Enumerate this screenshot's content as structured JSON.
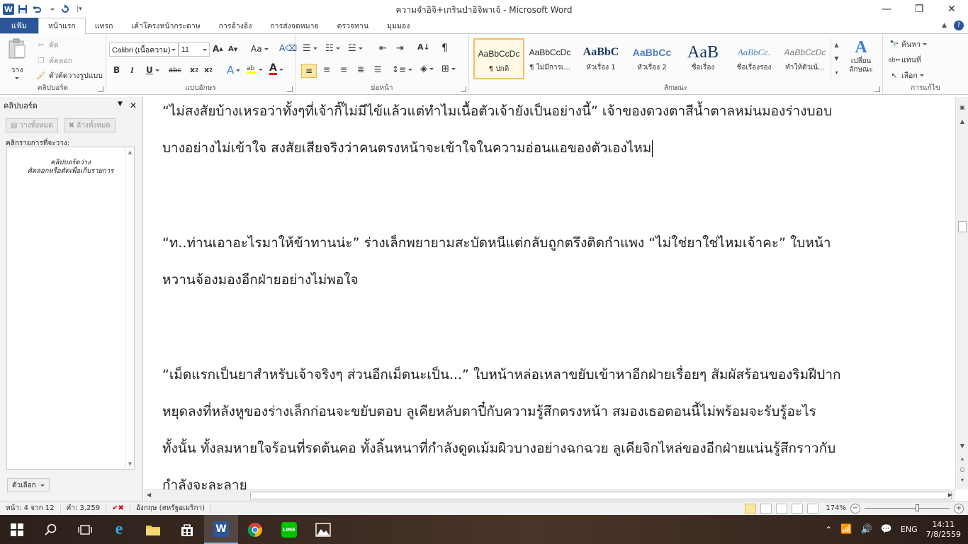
{
  "window": {
    "title": "ความจำอิจิ+เกรินป่าอิจิพาเจ้ - Microsoft Word",
    "logo_letter": "W"
  },
  "tabs": {
    "file": "แฟ้ม",
    "items": [
      "หน้าแรก",
      "แทรก",
      "เค้าโครงหน้ากระดาษ",
      "การอ้างอิง",
      "การส่งจดหมาย",
      "ตรวจทาน",
      "มุมมอง"
    ],
    "active_index": 0
  },
  "ribbon": {
    "clipboard": {
      "label": "คลิปบอร์ด",
      "paste": "วาง",
      "cut": "ตัด",
      "copy": "คัดลอก",
      "format_painter": "ตัวคัดวางรูปแบบ"
    },
    "font": {
      "label": "แบบอักษร",
      "font_name": "Calibri (เนื้อความ)",
      "font_size": "11",
      "change_case": "Aa"
    },
    "paragraph": {
      "label": "ย่อหน้า"
    },
    "styles": {
      "label": "ลักษณะ",
      "items": [
        {
          "preview": "AaBbCcDc",
          "name": "¶ ปกติ"
        },
        {
          "preview": "AaBbCcDc",
          "name": "¶ ไม่มีการเ..."
        },
        {
          "preview": "AaBbC",
          "name": "หัวเรื่อง 1"
        },
        {
          "preview": "AaBbCc",
          "name": "หัวเรื่อง 2"
        },
        {
          "preview": "AaB",
          "name": "ชื่อเรื่อง"
        },
        {
          "preview": "AaBbCc.",
          "name": "ชื่อเรื่องรอง"
        },
        {
          "preview": "AaBbCcDc",
          "name": "ทำให้ตัวเน้..."
        }
      ],
      "change_styles": "เปลี่ยน\nลักษณะ"
    },
    "editing": {
      "label": "การแก้ไข",
      "find": "ค้นหา",
      "replace": "แทนที่",
      "select": "เลือก"
    }
  },
  "clipboard_pane": {
    "title": "คลิปบอร์ด",
    "paste_all": "วางทั้งหมด",
    "clear_all": "ล้างทั้งหมด",
    "instruction": "คลิกรายการที่จะวาง:",
    "empty_line1": "คลิปบอร์ดว่าง",
    "empty_line2": "คัดลอกหรือตัดเพื่อเก็บรายการ",
    "options": "ตัวเลือก"
  },
  "document": {
    "lines": [
      "“ไม่สงสัยบ้างเหรอว่าทั้งๆที่เจ้ากิ๊ไม่มีไข้แล้วแต่ทำไมเนื้อตัวเจ้ายังเป็นอย่างนี้”  เจ้าของดวงตาสีน้ำตาลหม่นมองร่างบอบ",
      "บางอย่างไม่เข้าใจ สงสัยเสียจริงว่าคนตรงหน้าจะเข้าใจในความอ่อนแอของตัวเองไหม",
      "“ท..ท่านเอาอะไรมาให้ข้าทานน่ะ” ร่างเล็กพยายามสะบัดหนีแต่กลับถูกตรึงติดกำแพง  “ไม่ใช่ยาใช่ไหมเจ้าคะ” ใบหน้า",
      "หวานจ้องมองอีกฝ่ายอย่างไม่พอใจ",
      "“เม็ดแรกเป็นยาสำหรับเจ้าจริงๆ ส่วนอีกเม็ดนะเป็น...” ใบหน้าหล่อเหลาขยับเข้าหาอีกฝ่ายเรื่อยๆ สัมผัสร้อนของริมฝีปาก",
      "หยุดลงที่หลังหูของร่างเล็กก่อนจะขยับตอบ ลูเคียหลับตาปี๋กับความรู้สึกตรงหน้า  สมองเธอตอนนี้ไม่พร้อมจะรับรู้อะไร",
      "ทั้งนั้น ทั้งลมหายใจร้อนที่รดต้นคอ ทั้งลิ้นหนาที่กำลังดูดเม้มผิวบางอย่างฉกฉวย  ลูเคียจิกไหล่ของอีกฝ่ายแน่นรู้สึกราวกับ",
      "กำลังจะละลาย"
    ]
  },
  "status": {
    "page": "หน้า: 4 จาก 12",
    "words": "คำ: 3,259",
    "language": "อังกฤษ (สหรัฐอเมริกา)",
    "zoom": "174%"
  },
  "taskbar": {
    "lang": "ENG",
    "time": "14:11",
    "date": "7/8/2559"
  }
}
